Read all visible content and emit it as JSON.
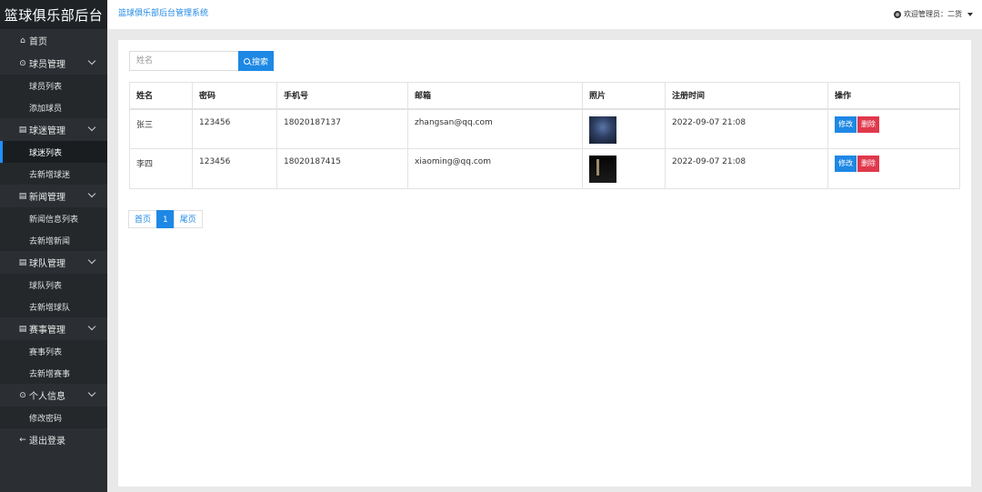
{
  "sidebar": {
    "brand": "篮球俱乐部后台",
    "home": {
      "label": "首页"
    },
    "groups": [
      {
        "label": "球员管理",
        "items": [
          "球员列表",
          "添加球员"
        ]
      },
      {
        "label": "球迷管理",
        "items": [
          "球迷列表",
          "去新增球迷"
        ]
      },
      {
        "label": "新闻管理",
        "items": [
          "新闻信息列表",
          "去新增新闻"
        ]
      },
      {
        "label": "球队管理",
        "items": [
          "球队列表",
          "去新增球队"
        ]
      },
      {
        "label": "赛事管理",
        "items": [
          "赛事列表",
          "去新增赛事"
        ]
      },
      {
        "label": "个人信息",
        "items": [
          "修改密码"
        ]
      }
    ],
    "logout": {
      "label": "退出登录"
    },
    "active_item": "球迷列表"
  },
  "header": {
    "title": "篮球俱乐部后台管理系统",
    "welcome": "欢迎管理员：二货"
  },
  "search": {
    "placeholder": "姓名",
    "value": "",
    "button_label": "搜索"
  },
  "table": {
    "columns": [
      "姓名",
      "密码",
      "手机号",
      "邮箱",
      "照片",
      "注册时间",
      "操作"
    ],
    "rows": [
      {
        "name": "张三",
        "password": "123456",
        "phone": "18020187137",
        "email": "zhangsan@qq.com",
        "registered": "2022-09-07 21:08",
        "edit": "修改",
        "delete": "删除"
      },
      {
        "name": "李四",
        "password": "123456",
        "phone": "18020187415",
        "email": "xiaoming@qq.com",
        "registered": "2022-09-07 21:08",
        "edit": "修改",
        "delete": "删除"
      }
    ]
  },
  "pagination": {
    "first": "首页",
    "current": "1",
    "last": "尾页"
  },
  "colors": {
    "primary": "#1e88e5",
    "danger": "#e0384c",
    "sidebar_bg": "#2b2f33"
  }
}
